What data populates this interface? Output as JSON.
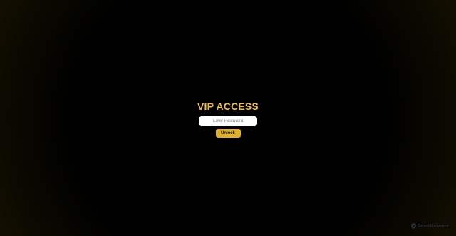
{
  "login": {
    "title": "VIP ACCESS",
    "password_placeholder": "Enter Password",
    "password_value": "",
    "unlock_label": "Unlock"
  },
  "watermark": {
    "text": "ScanMalware",
    "icon": "shield-icon"
  },
  "colors": {
    "accent": "#f2c12e",
    "button": "#e1b226",
    "background": "#000000",
    "edge_glow": "#1a1400"
  }
}
